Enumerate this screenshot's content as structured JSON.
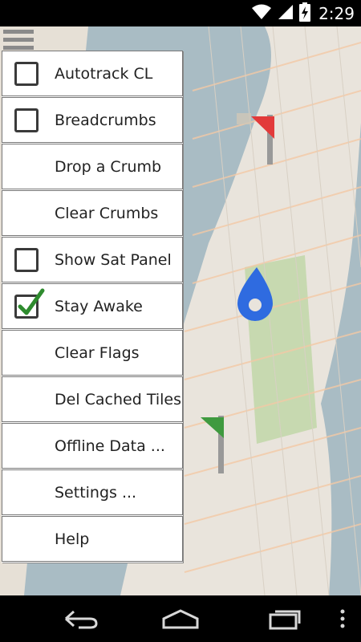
{
  "status_bar": {
    "time": "2:29",
    "icons": [
      "wifi-icon",
      "signal-icon",
      "battery-charging-icon"
    ]
  },
  "menu": {
    "items": [
      {
        "label": "Autotrack CL",
        "type": "checkbox",
        "checked": false
      },
      {
        "label": "Breadcrumbs",
        "type": "checkbox",
        "checked": false
      },
      {
        "label": "Drop a Crumb",
        "type": "action"
      },
      {
        "label": "Clear Crumbs",
        "type": "action"
      },
      {
        "label": "Show Sat Panel",
        "type": "checkbox",
        "checked": false
      },
      {
        "label": "Stay Awake",
        "type": "checkbox",
        "checked": true
      },
      {
        "label": "Clear Flags",
        "type": "action"
      },
      {
        "label": "Del Cached Tiles",
        "type": "action"
      },
      {
        "label": "Offline Data ...",
        "type": "action"
      },
      {
        "label": "Settings ...",
        "type": "action"
      },
      {
        "label": "Help",
        "type": "action"
      }
    ]
  },
  "map": {
    "markers": [
      "red-flag-icon",
      "green-flag-icon",
      "location-drop-icon"
    ]
  },
  "nav_bar": {
    "buttons": [
      "back-icon",
      "home-icon",
      "recents-icon",
      "overflow-menu-icon"
    ]
  },
  "colors": {
    "water": "#a9bcc4",
    "land": "#e9e4dc",
    "park": "#c7d9b0",
    "flag_red": "#e23a3a",
    "flag_green": "#3f9a3f",
    "location": "#2f6be0",
    "check": "#2e8b2e"
  }
}
